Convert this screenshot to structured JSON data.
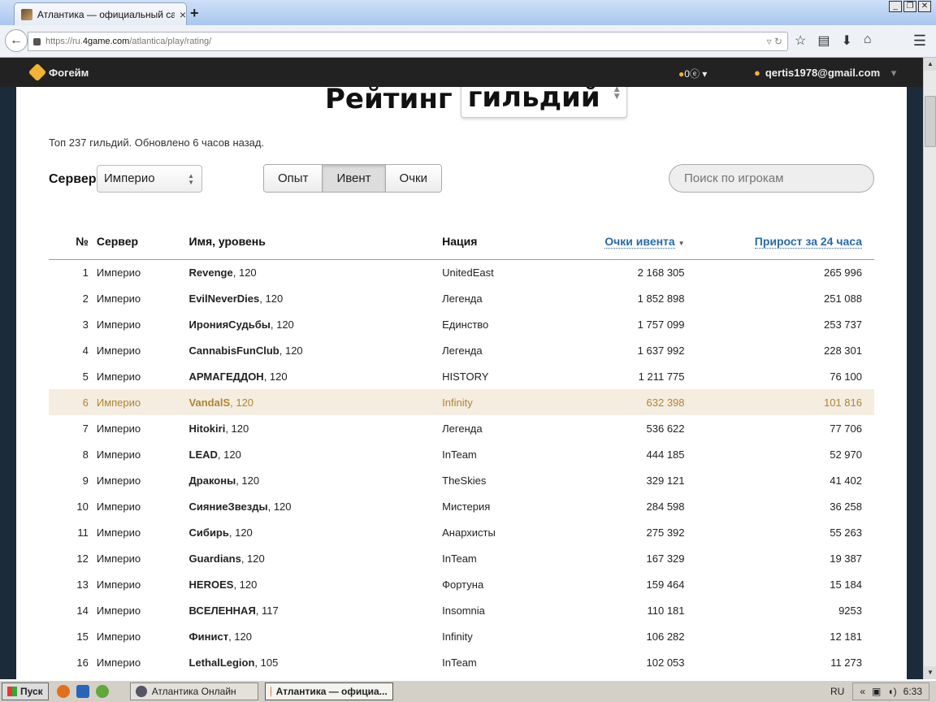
{
  "browser": {
    "tab_title": "Атлантика — официальный сай…",
    "tab_close": "×",
    "new_tab": "+",
    "url_prefix": "https://ru.",
    "url_domain": "4game.com",
    "url_path": "/atlantica/play/rating/"
  },
  "site": {
    "logo": "Фогейм",
    "balance": "0",
    "balance_currency": "ⓔ",
    "user": "qertis1978@gmail.com"
  },
  "page": {
    "heading": "Рейтинг",
    "heading_select": "гильдий",
    "subtitle": "Топ 237 гильдий. Обновлено 6 часов назад.",
    "server_label": "Сервер",
    "server_value": "Империо",
    "tabs": [
      "Опыт",
      "Ивент",
      "Очки"
    ],
    "active_tab": "Ивент",
    "search_placeholder": "Поиск по игрокам"
  },
  "table": {
    "headers": {
      "num": "№",
      "server": "Сервер",
      "name": "Имя, уровень",
      "nation": "Нация",
      "points": "Очки ивента",
      "points_sort": "▼",
      "growth": "Прирост за 24 часа"
    },
    "rows": [
      {
        "n": "1",
        "server": "Империо",
        "name": "Revenge",
        "level": ", 120",
        "nation": "UnitedEast",
        "points": "2 168 305",
        "growth": "265 996"
      },
      {
        "n": "2",
        "server": "Империо",
        "name": "EvilNeverDies",
        "level": ", 120",
        "nation": "Легенда",
        "points": "1 852 898",
        "growth": "251 088"
      },
      {
        "n": "3",
        "server": "Империо",
        "name": "ИронияСудьбы",
        "level": ", 120",
        "nation": "Единство",
        "points": "1 757 099",
        "growth": "253 737"
      },
      {
        "n": "4",
        "server": "Империо",
        "name": "CannabisFunClub",
        "level": ", 120",
        "nation": "Легенда",
        "points": "1 637 992",
        "growth": "228 301"
      },
      {
        "n": "5",
        "server": "Империо",
        "name": "АРМАГЕДДОН",
        "level": ", 120",
        "nation": "HISTORY",
        "points": "1 211 775",
        "growth": "76 100"
      },
      {
        "n": "6",
        "server": "Империо",
        "name": "VandalS",
        "level": ", 120",
        "nation": "Infinity",
        "points": "632 398",
        "growth": "101 816"
      },
      {
        "n": "7",
        "server": "Империо",
        "name": "Hitokiri",
        "level": ", 120",
        "nation": "Легенда",
        "points": "536 622",
        "growth": "77 706"
      },
      {
        "n": "8",
        "server": "Империо",
        "name": "LEAD",
        "level": ", 120",
        "nation": "InTeam",
        "points": "444 185",
        "growth": "52 970"
      },
      {
        "n": "9",
        "server": "Империо",
        "name": "Драконы",
        "level": ", 120",
        "nation": "TheSkies",
        "points": "329 121",
        "growth": "41 402"
      },
      {
        "n": "10",
        "server": "Империо",
        "name": "СияниеЗвезды",
        "level": ", 120",
        "nation": "Мистерия",
        "points": "284 598",
        "growth": "36 258"
      },
      {
        "n": "11",
        "server": "Империо",
        "name": "Сибирь",
        "level": ", 120",
        "nation": "Анархисты",
        "points": "275 392",
        "growth": "55 263"
      },
      {
        "n": "12",
        "server": "Империо",
        "name": "Guardians",
        "level": ", 120",
        "nation": "InTeam",
        "points": "167 329",
        "growth": "19 387"
      },
      {
        "n": "13",
        "server": "Империо",
        "name": "HEROES",
        "level": ", 120",
        "nation": "Фортуна",
        "points": "159 464",
        "growth": "15 184"
      },
      {
        "n": "14",
        "server": "Империо",
        "name": "ВСЕЛЕННАЯ",
        "level": ", 117",
        "nation": "Insomnia",
        "points": "110 181",
        "growth": "9253"
      },
      {
        "n": "15",
        "server": "Империо",
        "name": "Финист",
        "level": ", 120",
        "nation": "Infinity",
        "points": "106 282",
        "growth": "12 181"
      },
      {
        "n": "16",
        "server": "Империо",
        "name": "LethalLegion",
        "level": ", 105",
        "nation": "InTeam",
        "points": "102 053",
        "growth": "11 273"
      }
    ],
    "highlighted_row": "6"
  },
  "taskbar": {
    "start": "Пуск",
    "tasks": [
      "Атлантика Онлайн",
      "Атлантика — официа..."
    ],
    "lang": "RU",
    "clock": "6:33"
  },
  "colors": {
    "accent": "#2a6aa8",
    "highlight_bg": "#f4ede0",
    "highlight_text": "#b08432",
    "site_bar": "#222222"
  }
}
